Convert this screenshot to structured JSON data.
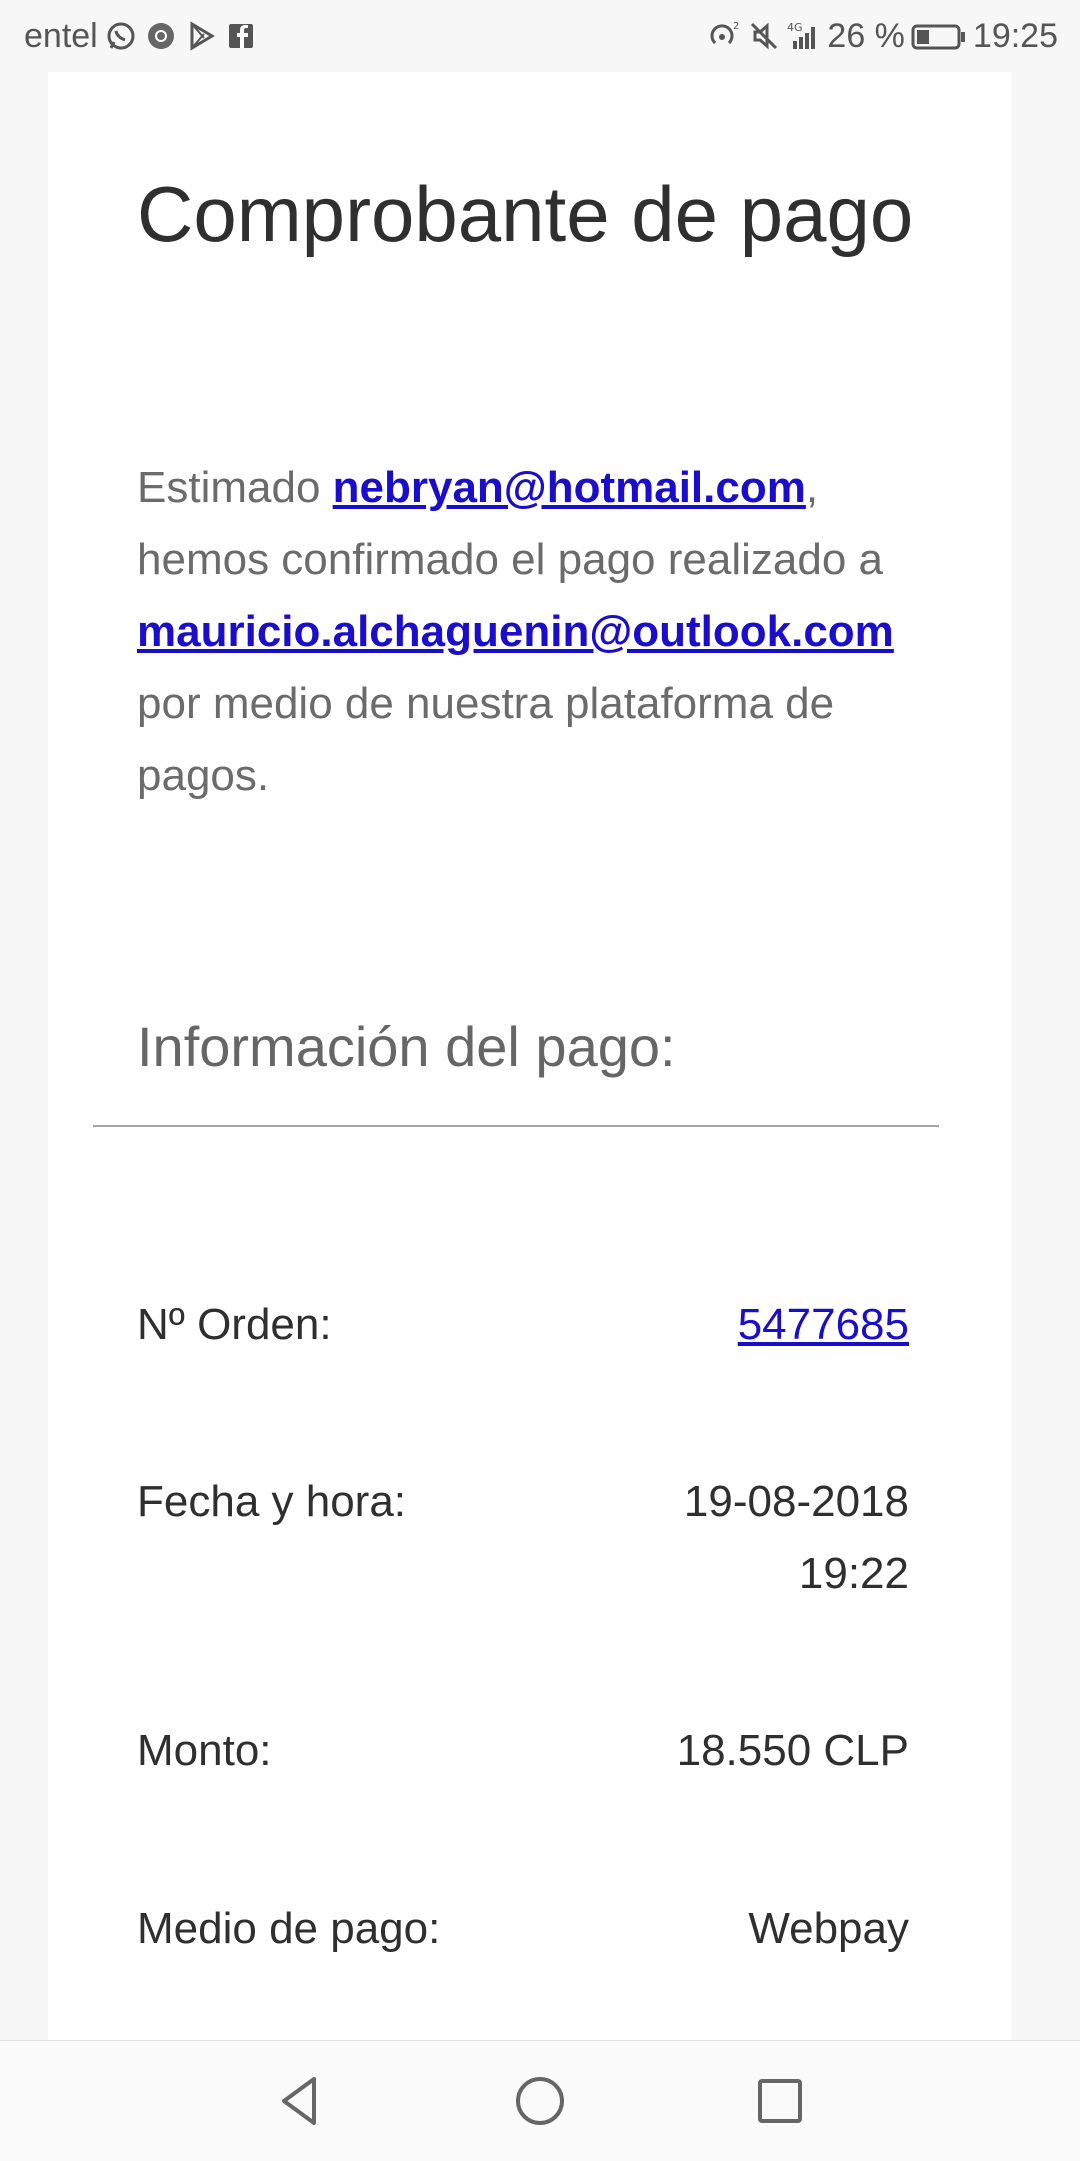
{
  "status_bar": {
    "carrier": "entel",
    "battery_text": "26 %",
    "time": "19:25",
    "left_icons": [
      "whatsapp-icon",
      "chrome-icon",
      "play-store-icon",
      "facebook-icon"
    ],
    "right_icons": [
      "hotspot-icon",
      "mute-icon",
      "signal-4g-icon",
      "battery-icon"
    ]
  },
  "receipt": {
    "title": "Comprobante de pago",
    "intro_prefix": "Estimado ",
    "payer_email": "nebryan@hotmail.com",
    "intro_mid": ", hemos confirmado el pago realizado a ",
    "payee_email": "mauricio.alchaguenin@outlook.com",
    "intro_suffix": " por medio de nuestra plataforma de pagos.",
    "section_title": "Información del pago:",
    "rows": [
      {
        "label": "Nº Orden:",
        "value": "5477685"
      },
      {
        "label": "Fecha y hora:",
        "value_date": "19-08-2018",
        "value_time": "19:22"
      },
      {
        "label": "Monto:",
        "value": "18.550 CLP"
      },
      {
        "label": "Medio de pago:",
        "value": "Webpay"
      }
    ]
  },
  "nav_bar": {
    "buttons": [
      "back-icon",
      "home-icon",
      "recents-icon"
    ]
  },
  "colors": {
    "link": "#1a0dcc",
    "card_bg": "#ffffff",
    "page_bg": "#f7f7f7",
    "text_dark": "#2f2f2f",
    "text_muted": "#6b6b6b"
  }
}
